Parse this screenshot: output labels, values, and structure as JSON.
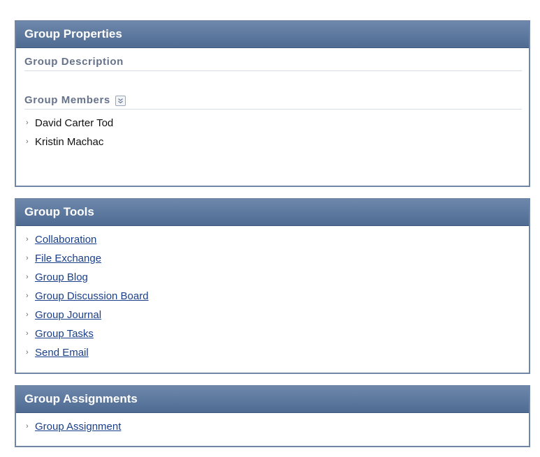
{
  "group_properties": {
    "title": "Group Properties",
    "description_heading": "Group Description",
    "members_heading": "Group Members",
    "members_toggle_icon": "double-chevron-down-icon",
    "members": [
      "David Carter Tod",
      "Kristin Machac"
    ]
  },
  "group_tools": {
    "title": "Group Tools",
    "items": [
      "Collaboration",
      "File Exchange",
      "Group Blog",
      "Group Discussion Board",
      "Group Journal",
      "Group Tasks",
      "Send Email"
    ]
  },
  "group_assignments": {
    "title": "Group Assignments",
    "items": [
      "Group Assignment"
    ]
  },
  "colors": {
    "header_bg": "#5a7399",
    "border": "#6f86a6",
    "link": "#1a3f8a",
    "section_title": "#66738a"
  }
}
